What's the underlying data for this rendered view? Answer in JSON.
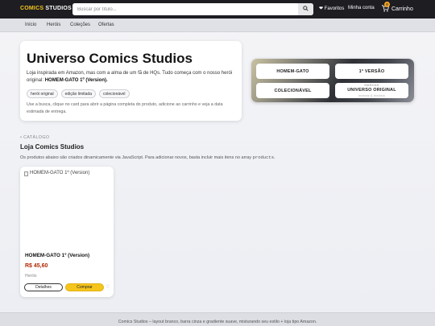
{
  "header": {
    "logo_part1": "COMICS",
    "logo_part2": "STUDIOS",
    "search_placeholder": "Buscar por título...",
    "search_icon": "search-icon",
    "favorites_label": "❤ Favoritos",
    "account_label": "Minha conta",
    "cart_count": "0",
    "cart_label": "Carrinho",
    "cart_icon": "cart-icon"
  },
  "subnav": {
    "items": [
      "Início",
      "Heróis",
      "Coleções",
      "Ofertas"
    ]
  },
  "hero": {
    "title": "Universo Comics Studios",
    "desc_prefix": "Loja inspirada em Amazon, mas com a alma de um fã de HQs. Tudo começa com o nosso herói original:",
    "desc_highlight": "HOMEM-GATO 1º (Version).",
    "tags": [
      "herói original",
      "edição limitada",
      "colecionável"
    ],
    "hint": "Use a busca, clique no card para abrir a página completa do produto, adicione ao carrinho e veja a data estimada de entrega."
  },
  "feature_panel": {
    "buttons": [
      "HOMEM-GATO",
      "1ª VERSÃO",
      "COLECIONÁVEL"
    ],
    "last_button_top": "MARCAS",
    "last_button_main": "UNIVERSO ORIGINAL",
    "last_button_sub": "marcas & história"
  },
  "catalog": {
    "eyebrow": "• CATÁLOGO",
    "title": "Loja Comics Studios",
    "subtitle_prefix": "Os produtos abaixo são criados dinamicamente via JavaScript. Para adicionar novos, basta incluir mais itens no array",
    "subtitle_code": "products",
    "subtitle_suffix": "."
  },
  "product": {
    "image_alt": "HOMEM-GATO 1º (Version)",
    "name": "HOMEM-GATO 1º (Version)",
    "price": "R$ 45,60",
    "category": "Heróis",
    "details_label": "Detalhes",
    "buy_label": "Comprar",
    "favorite_icon": "heart-icon"
  },
  "footer": {
    "text": "Comics Studios – layout branco, barra cinza e gradiente suave, misturando seu estilo + loja tipo Amazon."
  }
}
